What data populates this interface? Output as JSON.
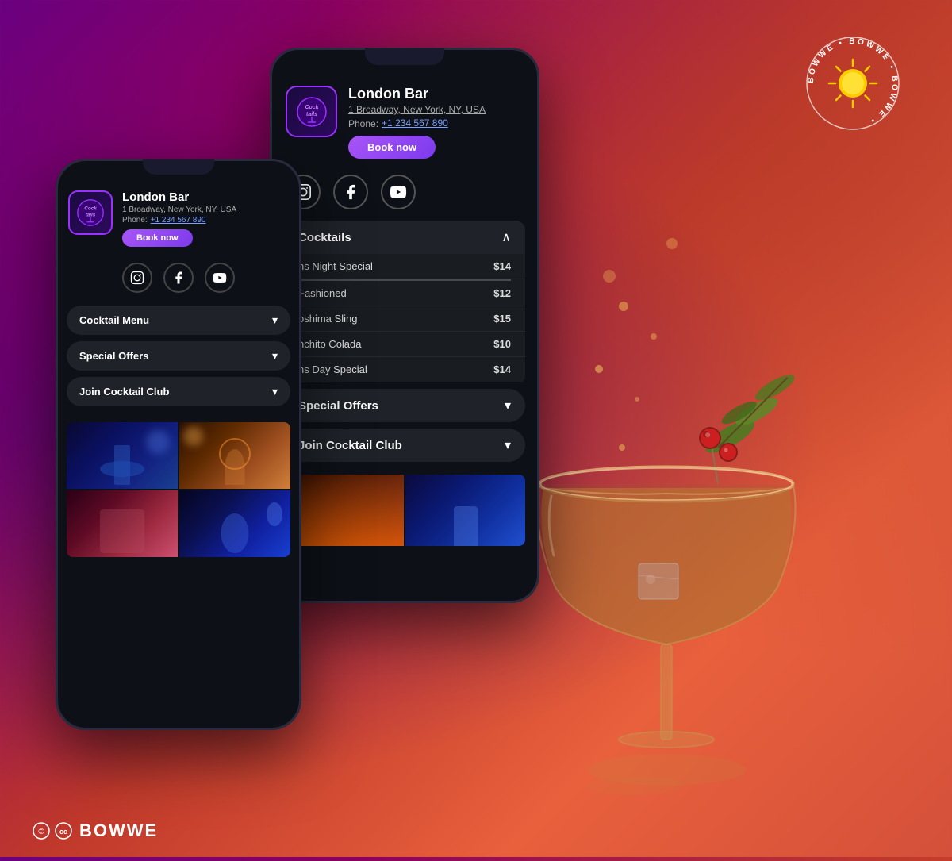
{
  "background": {
    "gradient_start": "#6a0080",
    "gradient_end": "#e8603c"
  },
  "bowwe_badge": {
    "text": "BOWWE • BOWWE • BOWWE •",
    "center_icon": "sun"
  },
  "footer": {
    "icons": [
      "copyright-icon",
      "creative-commons-icon"
    ],
    "brand": "BOWWE"
  },
  "phone_front": {
    "position": "left",
    "bar": {
      "name": "London Bar",
      "address": "1 Broadway, New York, NY, USA",
      "phone_label": "Phone:",
      "phone_number": "+1 234 567 890",
      "book_button": "Book now"
    },
    "social": [
      "instagram",
      "facebook",
      "youtube"
    ],
    "menu_items": [
      {
        "label": "Cocktail Menu",
        "arrow": "▾",
        "open": false
      },
      {
        "label": "Special Offers",
        "arrow": "▾",
        "open": false
      },
      {
        "label": "Join Cocktail Club",
        "arrow": "▾",
        "open": false
      }
    ],
    "photos": [
      {
        "type": "blue-cocktail"
      },
      {
        "type": "orange-cocktail"
      },
      {
        "type": "pink-cocktail"
      },
      {
        "type": "blue2-cocktail"
      }
    ]
  },
  "phone_back": {
    "position": "right",
    "bar": {
      "name": "London Bar",
      "address": "1 Broadway, New York, NY, USA",
      "phone_label": "Phone:",
      "phone_number": "+1 234 567 890",
      "book_button": "Book now"
    },
    "social": [
      "instagram",
      "facebook",
      "youtube"
    ],
    "cocktails_section": {
      "label": "Cocktails",
      "open": true,
      "items": [
        {
          "name": "ns Night Special",
          "price": "$14"
        },
        {
          "name": "Fashioned",
          "price": "$12"
        },
        {
          "name": "oshima Sling",
          "price": "$15"
        },
        {
          "name": "nchito Colada",
          "price": "$10"
        },
        {
          "name": "ns Day Special",
          "price": "$14"
        }
      ]
    },
    "menu_items": [
      {
        "label": "Special Offers",
        "arrow": "▾"
      },
      {
        "label": "Join Cocktail Club",
        "arrow": "▾"
      }
    ],
    "photos": [
      {
        "type": "fire-cocktail"
      },
      {
        "type": "blue-cocktail2"
      }
    ]
  },
  "cocktail_glass": {
    "color_main": "#c87941",
    "color_rim": "#e8a060",
    "garnish": "cherry and olive branch"
  }
}
